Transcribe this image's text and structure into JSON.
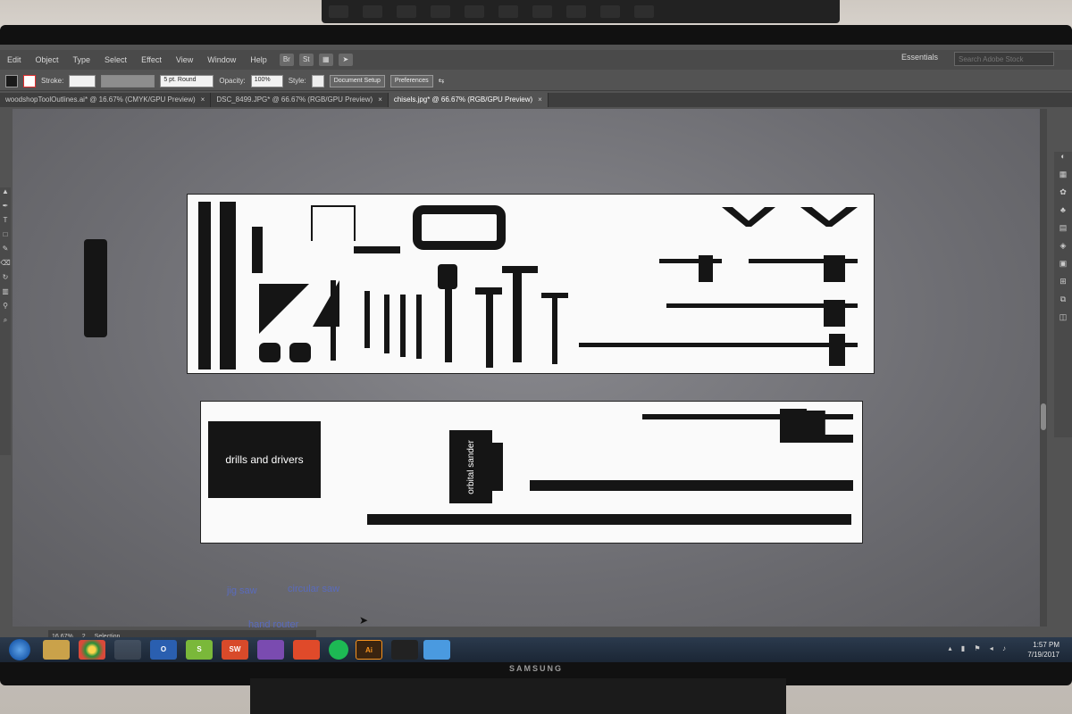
{
  "menubar": {
    "items": [
      "Edit",
      "Object",
      "Type",
      "Select",
      "Effect",
      "View",
      "Window",
      "Help"
    ],
    "app_icons": [
      "Br",
      "St"
    ],
    "workspace": "Essentials",
    "stock_search_placeholder": "Search Adobe Stock"
  },
  "controlbar": {
    "stroke_label": "Stroke:",
    "brush_value": "5 pt. Round",
    "opacity_label": "Opacity:",
    "opacity_value": "100%",
    "style_label": "Style:",
    "document_setup": "Document Setup",
    "preferences": "Preferences",
    "colors": {
      "fill": "#1a1a1a",
      "stroke": "#e03030"
    }
  },
  "tabs": [
    {
      "label": "woodshopToolOutlines.ai* @ 16.67% (CMYK/GPU Preview)"
    },
    {
      "label": "DSC_8499.JPG* @ 66.67% (RGB/GPU Preview)"
    },
    {
      "label": "chisels.jpg* @ 66.67% (RGB/GPU Preview)"
    }
  ],
  "canvas": {
    "drills_label": "drills and drivers",
    "sander_label": "orbital sander",
    "jig_saw": "jig saw",
    "circular_saw": "circular saw",
    "hand_router": "hand router"
  },
  "status": {
    "zoom": "16.67%",
    "artboard": "2",
    "tool": "Selection"
  },
  "taskbar": {
    "buttons": [
      "",
      "",
      "",
      "",
      "O",
      "S",
      "SW",
      "",
      "",
      "",
      "Ai",
      "",
      ""
    ],
    "time": "1:57 PM",
    "date": "7/19/2017"
  },
  "monitor": {
    "brand": "SAMSUNG"
  }
}
